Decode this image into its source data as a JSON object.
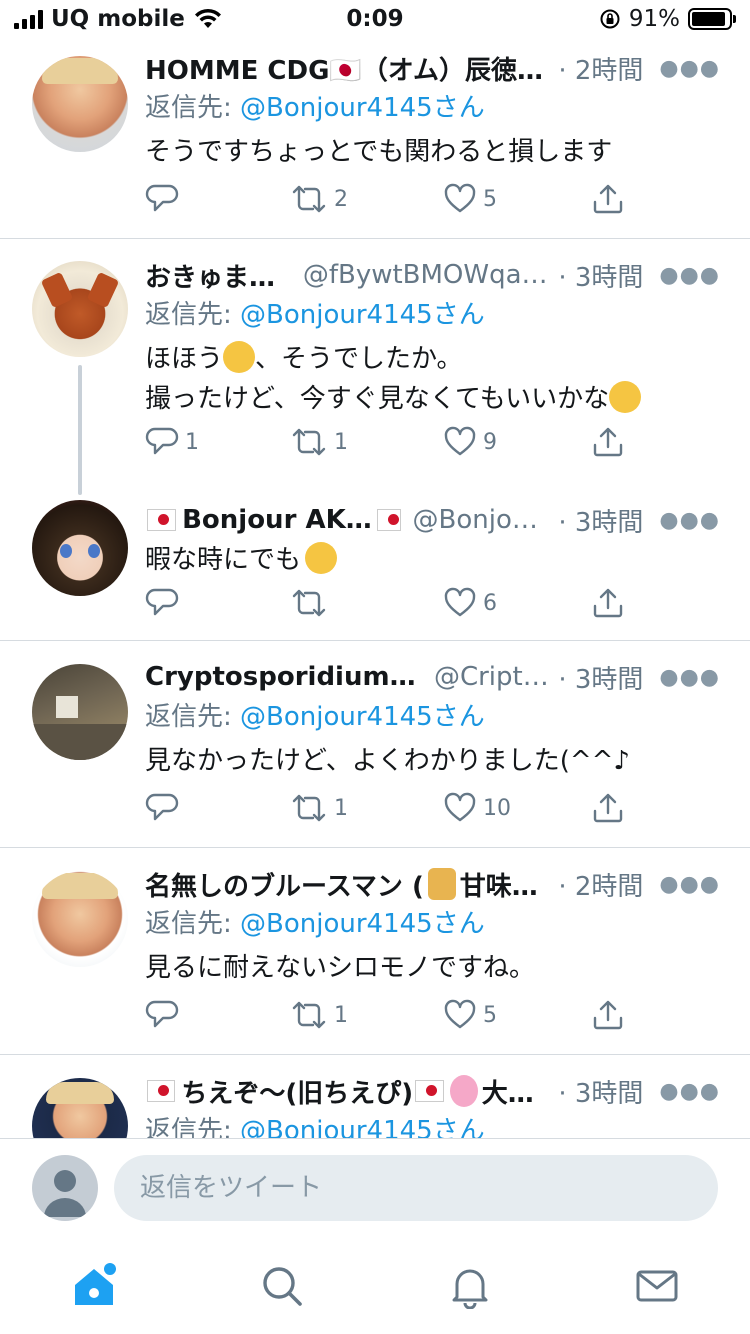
{
  "status_bar": {
    "carrier": "UQ mobile",
    "time": "0:09",
    "battery": "91%",
    "battery_level": 0.91
  },
  "tweets": [
    {
      "name": "HOMME CDG🇯🇵（オム）辰徳バ…",
      "handle": "",
      "time": "· 2時間",
      "reply_prefix": "返信先: ",
      "reply_mention": "@Bonjour4145さん",
      "text": "そうですちょっとでも関わると損します",
      "replies": "",
      "retweets": "2",
      "likes": "5"
    },
    {
      "name": "おきゅまきゅ",
      "handle": "@fBywtBMOWqap…",
      "time": "· 3時間",
      "reply_prefix": "返信先: ",
      "reply_mention": "@Bonjour4145さん",
      "text_line1_a": "ほほう",
      "text_line1_b": "、そうでしたか。",
      "text_line2": "撮ったけど、今すぐ見なくてもいいかな",
      "replies": "1",
      "retweets": "1",
      "likes": "9"
    },
    {
      "name": "Bonjour AKIRA",
      "handle": "@Bonjour…",
      "time": "· 3時間",
      "text": "暇な時にでも",
      "replies": "",
      "retweets": "",
      "likes": "6"
    },
    {
      "name": "Cryptosporidium_FLG",
      "handle": "@Cripto…",
      "time": "· 3時間",
      "reply_prefix": "返信先: ",
      "reply_mention": "@Bonjour4145さん",
      "text": "見なかったけど、よくわかりました(^^♪",
      "replies": "",
      "retweets": "1",
      "likes": "10"
    },
    {
      "name_a": "名無しのブルースマン (",
      "name_b": "甘味亭…",
      "handle": "",
      "time": "· 2時間",
      "reply_prefix": "返信先: ",
      "reply_mention": "@Bonjour4145さん",
      "text": "見るに耐えないシロモノですね。",
      "replies": "",
      "retweets": "1",
      "likes": "5"
    },
    {
      "name_a": "ちえぞ〜(旧ちえぴ)",
      "name_b": "大和…",
      "handle": "",
      "time": "· 3時間",
      "reply_prefix": "返信先: ",
      "reply_mention": "@Bonjour4145さん"
    }
  ],
  "reply_bar": {
    "placeholder": "返信をツイート"
  },
  "tabs": [
    "home-icon",
    "search-icon",
    "notifications-icon",
    "messages-icon"
  ],
  "colors": {
    "accent": "#1da1f2",
    "mention": "#1b95e0",
    "secondary": "#657786"
  }
}
